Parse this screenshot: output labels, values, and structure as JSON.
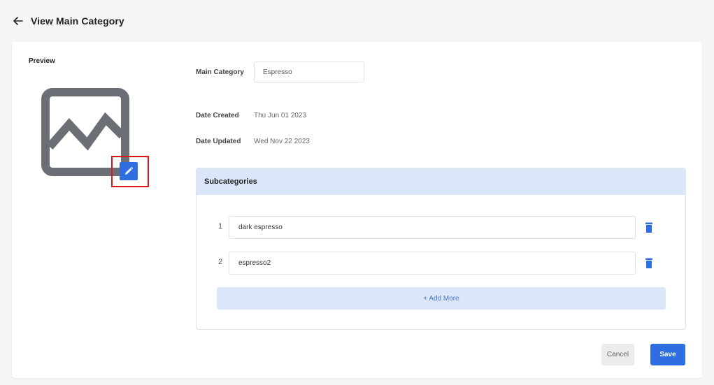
{
  "header": {
    "title": "View Main Category",
    "back_icon": "arrow-left-icon"
  },
  "preview": {
    "label": "Preview",
    "image_icon": "image-placeholder-icon",
    "edit_icon": "pencil-icon",
    "highlight_color": "#e0141b"
  },
  "fields": {
    "main_category_label": "Main Category",
    "main_category_value": "Espresso",
    "date_created_label": "Date Created",
    "date_created_value": "Thu Jun 01 2023",
    "date_updated_label": "Date Updated",
    "date_updated_value": "Wed Nov 22 2023"
  },
  "subcategories": {
    "title": "Subcategories",
    "items": [
      {
        "index": "1",
        "value": "dark espresso",
        "delete_icon": "trash-icon"
      },
      {
        "index": "2",
        "value": "espresso2",
        "delete_icon": "trash-icon"
      }
    ],
    "add_more_label": "+ Add More"
  },
  "actions": {
    "cancel_label": "Cancel",
    "save_label": "Save"
  },
  "colors": {
    "accent": "#2f6ee0",
    "panel_header": "#dbe6f8",
    "placeholder_icon": "#6b6f75"
  }
}
